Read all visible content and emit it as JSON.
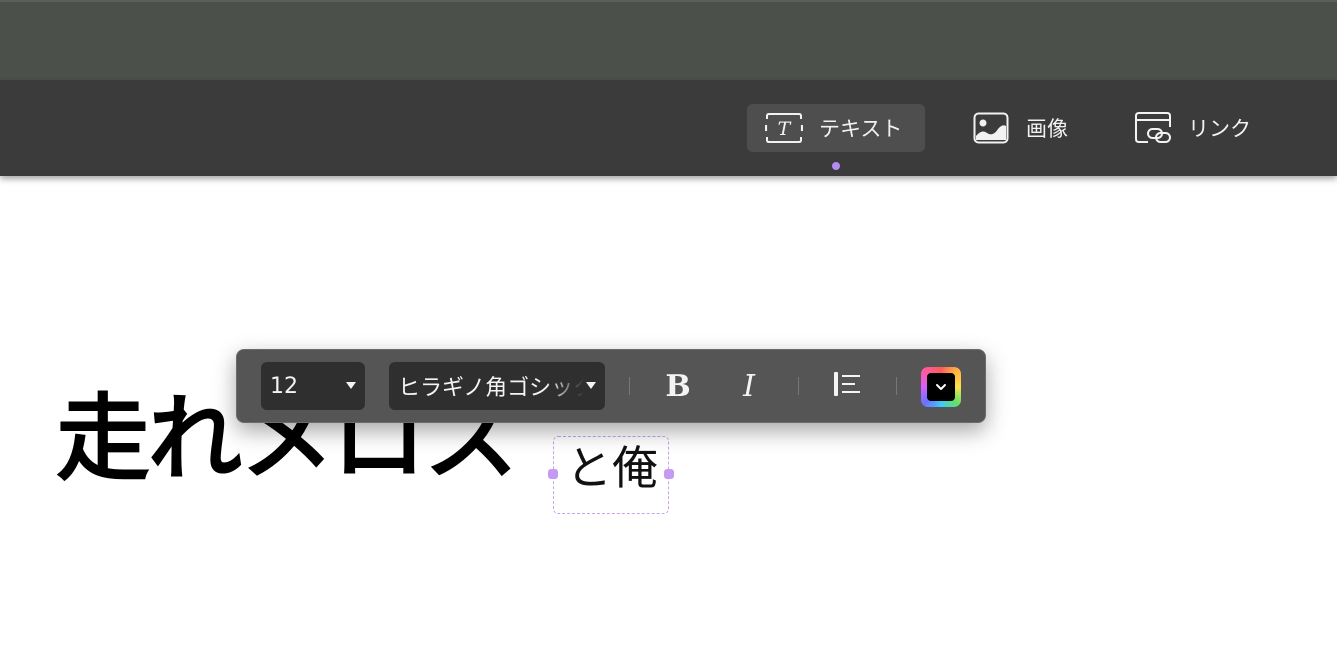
{
  "toolbar": {
    "items": [
      {
        "label": "テキスト",
        "icon": "text-frame-icon",
        "active": true
      },
      {
        "label": "画像",
        "icon": "image-icon",
        "active": false
      },
      {
        "label": "リンク",
        "icon": "link-window-icon",
        "active": false
      }
    ],
    "accent_color": "#b58cf2"
  },
  "canvas": {
    "heading": "走れメロス",
    "selected_text": "と俺"
  },
  "format_bar": {
    "font_size": "12",
    "font_family": "ヒラギノ角ゴシック",
    "bold_icon": "bold-icon",
    "italic_icon": "italic-icon",
    "align_icon": "align-left-icon",
    "color_icon": "text-color-picker-icon"
  }
}
